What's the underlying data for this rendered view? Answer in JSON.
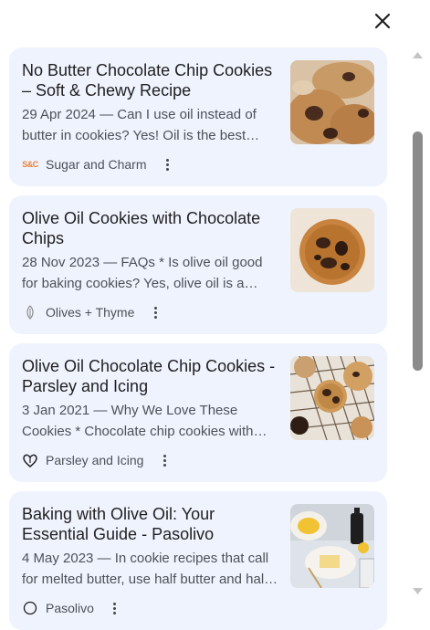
{
  "panel": {
    "close_label": "close"
  },
  "results": [
    {
      "title": "No Butter Chocolate Chip Cookies – Soft & Chewy Recipe",
      "snippet": "29 Apr 2024 — Can I use oil instead of butter in cookies? Yes! Oil is the best alternative to butter in cookies.",
      "source": "Sugar and Charm",
      "source_icon": "sugar-and-charm-logo-icon",
      "logo_text": "S&C"
    },
    {
      "title": "Olive Oil Cookies with Chocolate Chips",
      "snippet": "28 Nov 2023 — FAQs * Is olive oil good for baking cookies? Yes, olive oil is a wonderful choice.",
      "source": "Olives + Thyme",
      "source_icon": "olives-thyme-logo-icon"
    },
    {
      "title": "Olive Oil Chocolate Chip Cookies - Parsley and Icing",
      "snippet": "3 Jan 2021 — Why We Love These Cookies * Chocolate chip cookies with olive oil are chewy.",
      "source": "Parsley and Icing",
      "source_icon": "heart-leaf-logo-icon"
    },
    {
      "title": "Baking with Olive Oil: Your Essential Guide - Pasolivo",
      "snippet": "4 May 2023 — In cookie recipes that call for melted butter, use half butter and half olive oil.",
      "source": "Pasolivo",
      "source_icon": "pasolivo-logo-icon"
    }
  ],
  "colors": {
    "card_background": "#eff3fe",
    "title_text": "#1f1f1f",
    "snippet_text": "#4d5156",
    "scrollbar_thumb": "#8b8b8b"
  }
}
